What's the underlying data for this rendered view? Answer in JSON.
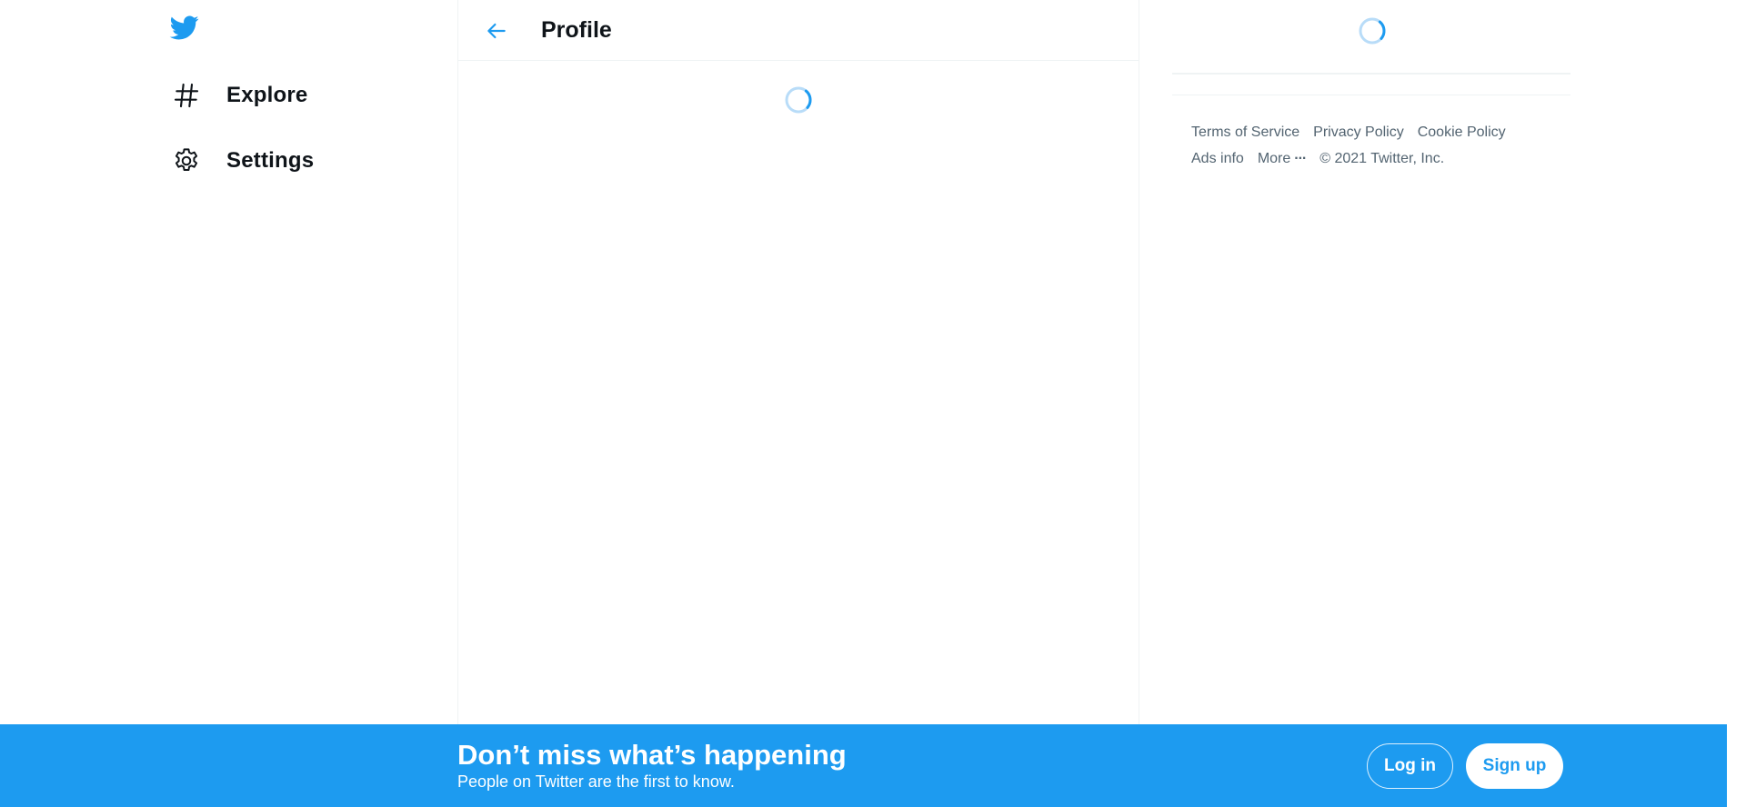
{
  "sidebar": {
    "logo_icon": "twitter-bird-icon",
    "items": [
      {
        "label": "Explore",
        "icon": "hashtag-icon"
      },
      {
        "label": "Settings",
        "icon": "gear-icon"
      }
    ]
  },
  "header": {
    "back_icon": "arrow-left-icon",
    "title": "Profile"
  },
  "main": {
    "loading_icon": "spinner-icon"
  },
  "right": {
    "loading_icon": "spinner-icon",
    "footer": {
      "links_row1": [
        "Terms of Service",
        "Privacy Policy",
        "Cookie Policy"
      ],
      "ads_info": "Ads info",
      "more": "More",
      "more_icon": "ellipsis-icon",
      "copyright": "© 2021 Twitter, Inc."
    }
  },
  "banner": {
    "title": "Don’t miss what’s happening",
    "subtitle": "People on Twitter are the first to know.",
    "login_label": "Log in",
    "signup_label": "Sign up"
  },
  "colors": {
    "brand": "#1d9bf0",
    "text_primary": "#0f1419",
    "text_secondary": "#536471",
    "border": "#eff3f4"
  }
}
